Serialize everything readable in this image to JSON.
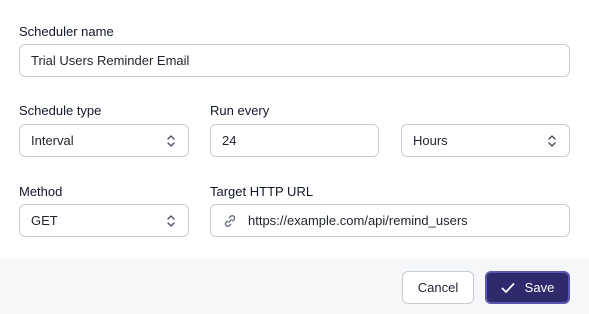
{
  "form": {
    "scheduler_name": {
      "label": "Scheduler name",
      "value": "Trial Users Reminder Email"
    },
    "schedule_type": {
      "label": "Schedule type",
      "value": "Interval"
    },
    "run_every": {
      "label": "Run every",
      "value": "24",
      "unit": "Hours"
    },
    "method": {
      "label": "Method",
      "value": "GET"
    },
    "target_url": {
      "label": "Target HTTP URL",
      "value": "https://example.com/api/remind_users"
    }
  },
  "footer": {
    "cancel_label": "Cancel",
    "save_label": "Save"
  },
  "colors": {
    "primary": "#2e2a6b",
    "primary_border": "#5b56b0",
    "footer_bg": "#f6f7f9",
    "field_border": "#c9ccd3"
  },
  "icons": {
    "select": "chevron-up-down-icon",
    "url": "link-icon",
    "save": "check-icon"
  }
}
